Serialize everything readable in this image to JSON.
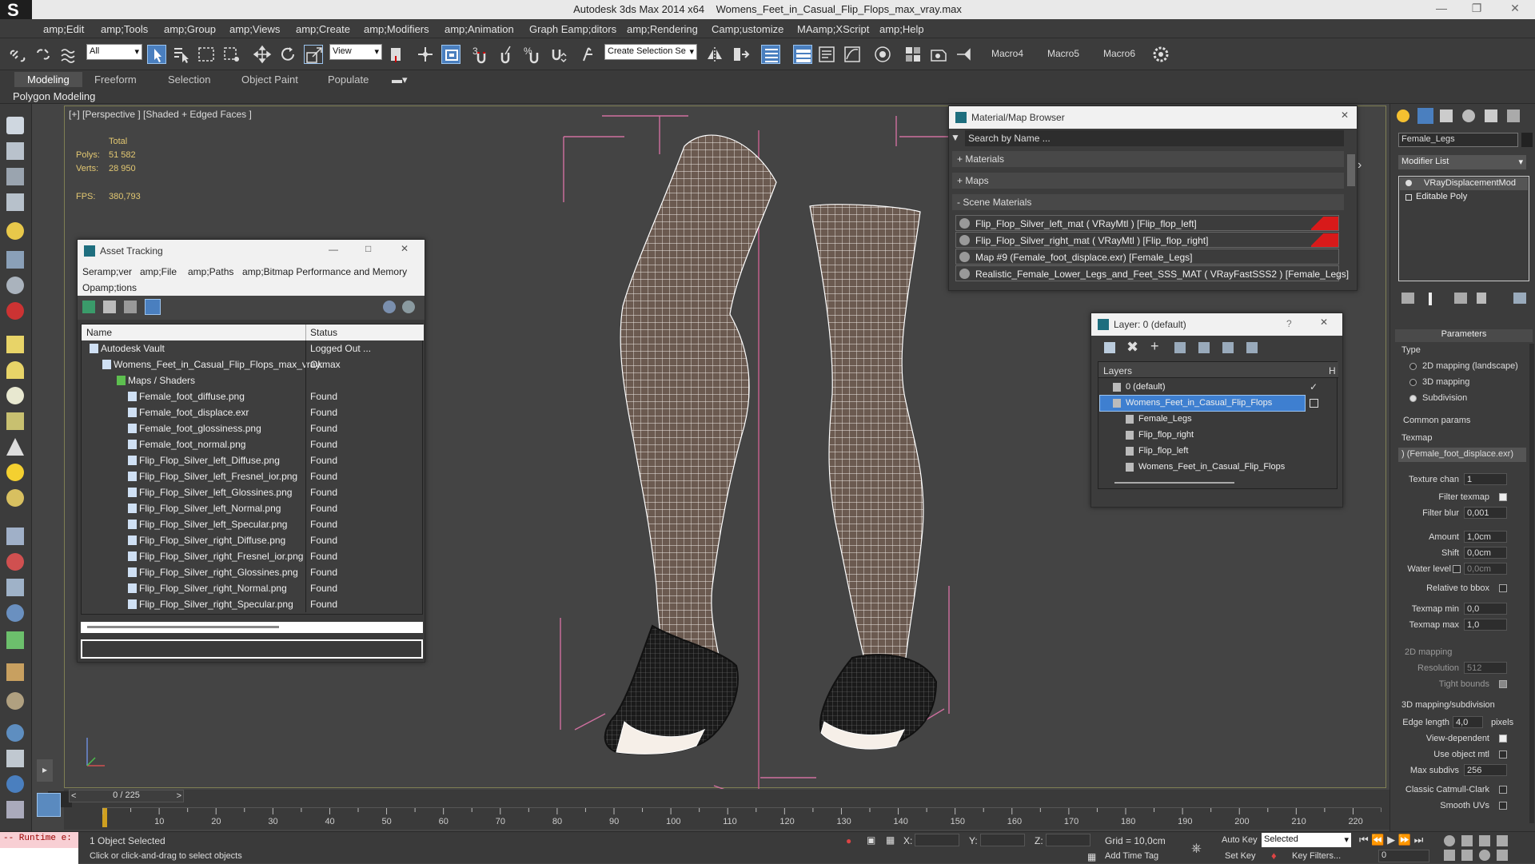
{
  "title": {
    "app": "Autodesk 3ds Max  2014 x64",
    "file": "Womens_Feet_in_Casual_Flip_Flops_max_vray.max"
  },
  "menu": [
    "amp;Edit",
    "amp;Tools",
    "amp;Group",
    "amp;Views",
    "amp;Create",
    "amp;Modifiers",
    "amp;Animation",
    "Graph Eamp;ditors",
    "amp;Rendering",
    "Camp;ustomize",
    "MAamp;XScript",
    "amp;Help"
  ],
  "toolbar": {
    "filter": "All",
    "refcoord": "View",
    "selection_set": "Create Selection Se",
    "macros": [
      "Macro4",
      "Macro5",
      "Macro6"
    ],
    "snap_labels": [
      "3",
      "%"
    ]
  },
  "ribbon": {
    "tabs": [
      "Modeling",
      "Freeform",
      "Selection",
      "Object Paint",
      "Populate"
    ],
    "active": "Modeling",
    "sub": "Polygon Modeling"
  },
  "viewport": {
    "label": "[+] [Perspective ] [Shaded + Edged Faces ]",
    "stats": {
      "total": "Total",
      "polys_label": "Polys:",
      "polys": "51 582",
      "verts_label": "Verts:",
      "verts": "28 950",
      "fps_label": "FPS:",
      "fps": "380,793"
    }
  },
  "asset_tracking": {
    "title": "Asset Tracking",
    "menu": [
      "Seramp;ver",
      "amp;File",
      "amp;Paths",
      "amp;Bitmap Performance and Memory",
      "Opamp;tions"
    ],
    "col_name": "Name",
    "col_status": "Status",
    "rows": [
      {
        "name": "Autodesk Vault",
        "status": "Logged Out ...",
        "indent": 0
      },
      {
        "name": "Womens_Feet_in_Casual_Flip_Flops_max_vray.max",
        "status": "Ok",
        "indent": 1
      },
      {
        "name": "Maps / Shaders",
        "status": "",
        "indent": 2
      },
      {
        "name": "Female_foot_diffuse.png",
        "status": "Found",
        "indent": 3
      },
      {
        "name": "Female_foot_displace.exr",
        "status": "Found",
        "indent": 3
      },
      {
        "name": "Female_foot_glossiness.png",
        "status": "Found",
        "indent": 3
      },
      {
        "name": "Female_foot_normal.png",
        "status": "Found",
        "indent": 3
      },
      {
        "name": "Flip_Flop_Silver_left_Diffuse.png",
        "status": "Found",
        "indent": 3
      },
      {
        "name": "Flip_Flop_Silver_left_Fresnel_ior.png",
        "status": "Found",
        "indent": 3
      },
      {
        "name": "Flip_Flop_Silver_left_Glossines.png",
        "status": "Found",
        "indent": 3
      },
      {
        "name": "Flip_Flop_Silver_left_Normal.png",
        "status": "Found",
        "indent": 3
      },
      {
        "name": "Flip_Flop_Silver_left_Specular.png",
        "status": "Found",
        "indent": 3
      },
      {
        "name": "Flip_Flop_Silver_right_Diffuse.png",
        "status": "Found",
        "indent": 3
      },
      {
        "name": "Flip_Flop_Silver_right_Fresnel_ior.png",
        "status": "Found",
        "indent": 3
      },
      {
        "name": "Flip_Flop_Silver_right_Glossines.png",
        "status": "Found",
        "indent": 3
      },
      {
        "name": "Flip_Flop_Silver_right_Normal.png",
        "status": "Found",
        "indent": 3
      },
      {
        "name": "Flip_Flop_Silver_right_Specular.png",
        "status": "Found",
        "indent": 3
      }
    ]
  },
  "material_browser": {
    "title": "Material/Map Browser",
    "search_placeholder": "Search by Name ...",
    "groups": [
      "+ Materials",
      "+ Maps",
      "- Scene Materials"
    ],
    "items": [
      {
        "label": "Flip_Flop_Silver_left_mat  ( VRayMtl ) [Flip_flop_left]",
        "flag": true
      },
      {
        "label": "Flip_Flop_Silver_right_mat  ( VRayMtl ) [Flip_flop_right]",
        "flag": true
      },
      {
        "label": "Map #9 (Female_foot_displace.exr) [Female_Legs]",
        "flag": false
      },
      {
        "label": "Realistic_Female_Lower_Legs_and_Feet_SSS_MAT  ( VRayFastSSS2 ) [Female_Legs]",
        "flag": false
      }
    ]
  },
  "layer": {
    "title": "Layer: 0 (default)",
    "help": "?",
    "col_layers": "Layers",
    "col_h": "H",
    "rows": [
      {
        "name": "0 (default)",
        "indent": 0,
        "selected": false
      },
      {
        "name": "Womens_Feet_in_Casual_Flip_Flops",
        "indent": 0,
        "selected": true
      },
      {
        "name": "Female_Legs",
        "indent": 1,
        "selected": false
      },
      {
        "name": "Flip_flop_right",
        "indent": 1,
        "selected": false
      },
      {
        "name": "Flip_flop_left",
        "indent": 1,
        "selected": false
      },
      {
        "name": "Womens_Feet_in_Casual_Flip_Flops",
        "indent": 1,
        "selected": false
      }
    ]
  },
  "command_panel": {
    "object_name": "Female_Legs",
    "modifier_list": "Modifier List",
    "stack": [
      "VRayDisplacementMod",
      "Editable Poly"
    ],
    "parameters": "Parameters",
    "type_label": "Type",
    "types": [
      {
        "label": "2D mapping (landscape)",
        "on": false
      },
      {
        "label": "3D mapping",
        "on": false
      },
      {
        "label": "Subdivision",
        "on": true
      }
    ],
    "common_params": "Common params",
    "texmap_label": "Texmap",
    "texmap": ") (Female_foot_displace.exr)",
    "texture_chan_label": "Texture chan",
    "texture_chan": "1",
    "filter_texmap": "Filter texmap",
    "filter_blur_label": "Filter blur",
    "filter_blur": "0,001",
    "amount_label": "Amount",
    "amount": "1,0cm",
    "shift_label": "Shift",
    "shift": "0,0cm",
    "water_level_label": "Water level",
    "water_level": "0,0cm",
    "relative_bbox": "Relative to bbox",
    "texmap_min_label": "Texmap min",
    "texmap_min": "0,0",
    "texmap_max_label": "Texmap max",
    "texmap_max": "1,0",
    "mapping2d": "2D mapping",
    "resolution_label": "Resolution",
    "resolution": "512",
    "tight_bounds": "Tight bounds",
    "mapping3d": "3D mapping/subdivision",
    "edge_length_label": "Edge length",
    "edge_length": "4,0",
    "pixels": "pixels",
    "view_dependent": "View-dependent",
    "use_object_mtl": "Use object mtl",
    "max_subdivs_label": "Max subdivs",
    "max_subdivs": "256",
    "catmull": "Classic Catmull-Clark",
    "smooth_uvs": "Smooth UVs"
  },
  "timeline": {
    "frame": "0 / 225",
    "ticks": [
      "10",
      "20",
      "30",
      "40",
      "50",
      "60",
      "70",
      "80",
      "90",
      "100",
      "110",
      "120",
      "130",
      "140",
      "150",
      "160",
      "170",
      "180",
      "190",
      "200",
      "210",
      "220"
    ]
  },
  "status": {
    "maxscript": "-- Runtime e:",
    "selected": "1 Object Selected",
    "prompt": "Click or click-and-drag to select objects",
    "x": "X:",
    "y": "Y:",
    "z": "Z:",
    "grid": "Grid = 10,0cm",
    "add_time_tag": "Add Time Tag",
    "auto_key": "Auto Key",
    "set_key": "Set Key",
    "key_mode": "Selected",
    "key_filters": "Key Filters...",
    "frame_field": "0"
  }
}
